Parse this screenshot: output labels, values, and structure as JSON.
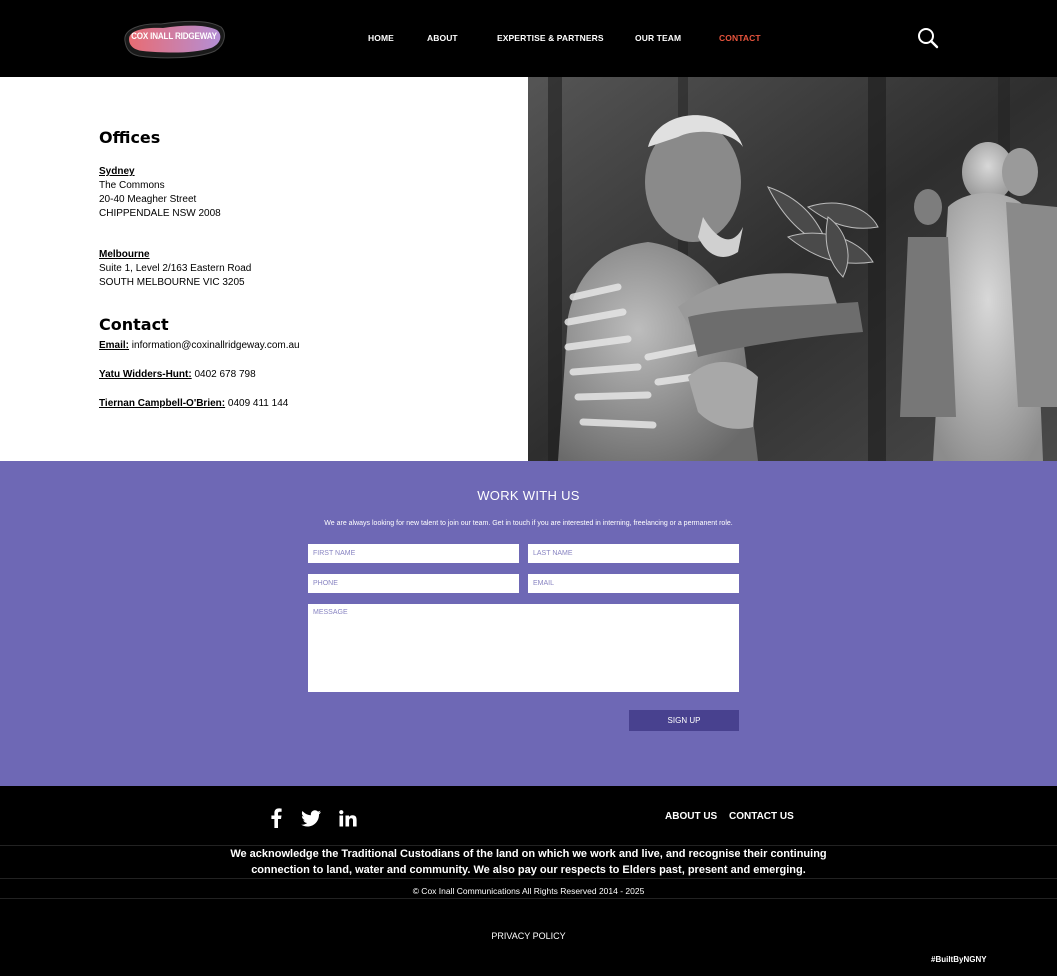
{
  "header": {
    "logo_text": "COX INALL RIDGEWAY",
    "nav": [
      {
        "label": "HOME"
      },
      {
        "label": "ABOUT"
      },
      {
        "label": "EXPERTISE & PARTNERS"
      },
      {
        "label": "OUR TEAM"
      },
      {
        "label": "CONTACT",
        "active": true
      }
    ],
    "active_color": "#e8543d"
  },
  "offices": {
    "title": "Offices",
    "sydney": {
      "city": "Sydney",
      "lines": [
        "The Commons",
        "20-40 Meagher Street",
        "CHIPPENDALE NSW 2008"
      ]
    },
    "melbourne": {
      "city": "Melbourne",
      "lines": [
        "Suite 1, Level 2/163 Eastern Road",
        "SOUTH MELBOURNE VIC 3205"
      ]
    }
  },
  "contact": {
    "title": "Contact",
    "email_label": "Email:",
    "email_value": "information@coxinallridgeway.com.au",
    "person1_label": "Yatu Widders-Hunt:",
    "person1_value": "0402 678 798",
    "person2_label": "Tiernan Campbell-O'Brien:",
    "person2_value": "0409 411 144"
  },
  "work": {
    "title": "WORK WITH US",
    "description": "We are always looking for new talent to join our team. Get in touch if you are interested in interning, freelancing or a permanent role.",
    "first_name_placeholder": "FIRST NAME",
    "last_name_placeholder": "LAST NAME",
    "phone_placeholder": "PHONE",
    "email_placeholder": "EMAIL",
    "message_placeholder": "MESSAGE",
    "submit_label": "SIGN UP",
    "bg_color": "#6e68b5",
    "button_color": "#48418f"
  },
  "footer": {
    "social": [
      "facebook-icon",
      "twitter-icon",
      "linkedin-icon"
    ],
    "about_link": "ABOUT US",
    "contact_link": "CONTACT US",
    "acknowledgement_line1": "We acknowledge the Traditional Custodians of the land on which we work and live, and recognise their continuing",
    "acknowledgement_line2": "connection to land, water and community. We also pay our respects to Elders past, present and emerging.",
    "copyright": "© Cox Inall Communications All Rights Reserved 2014 - 2025",
    "privacy": "PRIVACY POLICY",
    "built_by": "#BuiltByNGNY"
  }
}
